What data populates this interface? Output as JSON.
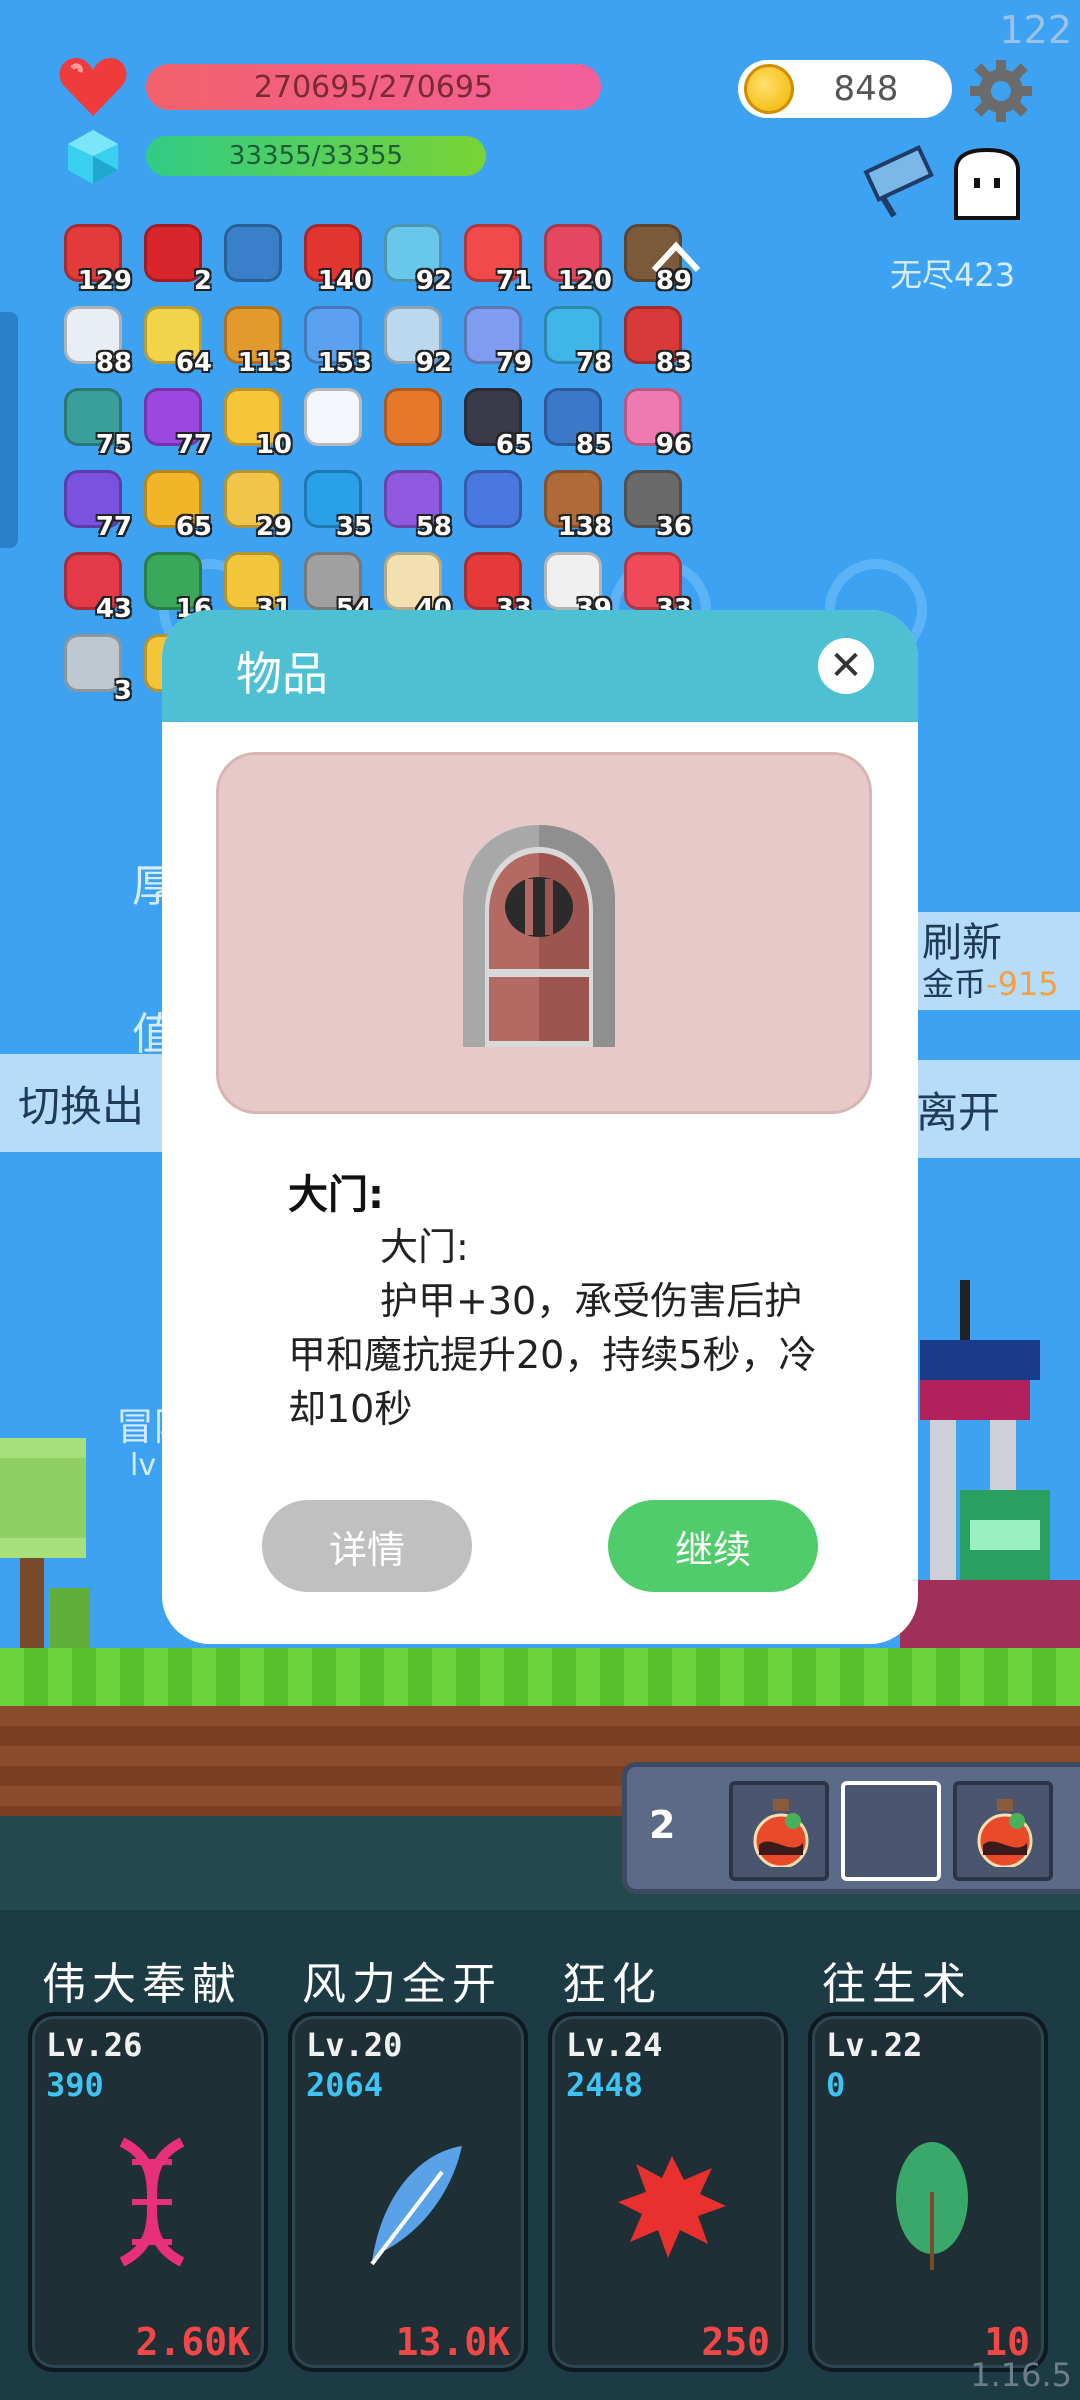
{
  "hud": {
    "fps": "122",
    "hp": "270695/270695",
    "mp": "33355/33355",
    "coins": "848",
    "mode": "无尽423",
    "version": "1.16.5"
  },
  "items": [
    {
      "icon": "red-boot-icon",
      "color": "#e33a3a",
      "count": "129"
    },
    {
      "icon": "magnet-icon",
      "color": "#d8262c",
      "count": "2"
    },
    {
      "icon": "magnifier-icon",
      "color": "#3a80c8",
      "count": ""
    },
    {
      "icon": "apple-icon",
      "color": "#e3352f",
      "count": "140"
    },
    {
      "icon": "potion-icon",
      "color": "#69c8ea",
      "count": "92"
    },
    {
      "icon": "pill-icon",
      "color": "#f04a4a",
      "count": "71"
    },
    {
      "icon": "jam-jar-icon",
      "color": "#e64760",
      "count": "120"
    },
    {
      "icon": "coconut-icon",
      "color": "#7b5a3b",
      "count": "89"
    },
    {
      "icon": "envelope-icon",
      "color": "#e9eef4",
      "count": "88"
    },
    {
      "icon": "halo-icon",
      "color": "#f3d34a",
      "count": "64"
    },
    {
      "icon": "book-icon",
      "color": "#e39a2d",
      "count": "113"
    },
    {
      "icon": "star-card-icon",
      "color": "#5aa2f0",
      "count": "153"
    },
    {
      "icon": "flask-icon",
      "color": "#bcd8ee",
      "count": "92"
    },
    {
      "icon": "capsule-icon",
      "color": "#7f9cf0",
      "count": "79"
    },
    {
      "icon": "speech-bubble-icon",
      "color": "#3fb5e8",
      "count": "78"
    },
    {
      "icon": "red-shield-icon",
      "color": "#d83a3a",
      "count": "83"
    },
    {
      "icon": "disc-icon",
      "color": "#3a9f9a",
      "count": "75"
    },
    {
      "icon": "crystal-ball-icon",
      "color": "#9b47e0",
      "count": "77"
    },
    {
      "icon": "sun-icon",
      "color": "#f6c63a",
      "count": "10"
    },
    {
      "icon": "wing-icon",
      "color": "#f3f6fb",
      "count": ""
    },
    {
      "icon": "orange-potion-icon",
      "color": "#e6782a",
      "count": ""
    },
    {
      "icon": "cauldron-icon",
      "color": "#3a3a48",
      "count": "65"
    },
    {
      "icon": "blue-shield-icon",
      "color": "#3a78c8",
      "count": "85"
    },
    {
      "icon": "spray-bottle-icon",
      "color": "#f07ab0",
      "count": "96"
    },
    {
      "icon": "purple-box-icon",
      "color": "#7b52e0",
      "count": "77"
    },
    {
      "icon": "sunflower-icon",
      "color": "#f2b52a",
      "count": "65"
    },
    {
      "icon": "ring-icon",
      "color": "#f1c54a",
      "count": "29"
    },
    {
      "icon": "blue-gem-icon",
      "color": "#2aa0e8",
      "count": "35"
    },
    {
      "icon": "purple-shield-icon",
      "color": "#8f5ae0",
      "count": "58"
    },
    {
      "icon": "tarot-card-icon",
      "color": "#4a78e0",
      "count": ""
    },
    {
      "icon": "donut-icon",
      "color": "#b06a3a",
      "count": "138"
    },
    {
      "icon": "hook-icon",
      "color": "#6a6a6a",
      "count": "36"
    },
    {
      "icon": "heart-plus-icon",
      "color": "#e33a4a",
      "count": "43"
    },
    {
      "icon": "cash-icon",
      "color": "#3aa85a",
      "count": "16"
    },
    {
      "icon": "magic-wand-icon",
      "color": "#f2c53a",
      "count": "31"
    },
    {
      "icon": "door-icon",
      "color": "#a0a0a0",
      "count": "54"
    },
    {
      "icon": "milk-icon",
      "color": "#f3e0b0",
      "count": "40"
    },
    {
      "icon": "strawberry-icon",
      "color": "#e63a3a",
      "count": "33"
    },
    {
      "icon": "egg-icon",
      "color": "#f0f0f0",
      "count": "39"
    },
    {
      "icon": "big-heart-icon",
      "color": "#ef4a5a",
      "count": "33"
    },
    {
      "icon": "compass-icon",
      "color": "#bfc8cf",
      "count": "3"
    },
    {
      "icon": "crown-icon",
      "color": "#f3c53a",
      "count": ""
    },
    {
      "icon": "light-tile-icon",
      "color": "#8ee0f0",
      "count": ""
    }
  ],
  "background_ui": {
    "refresh_label": "刷新",
    "refresh_cost_prefix": "金币",
    "refresh_cost": "-915",
    "leave_label": "离开",
    "switch_label": "切换出",
    "partial_1": "厚",
    "partial_2": "值",
    "partial_3": "冒险",
    "partial_4": "lv"
  },
  "slots": {
    "count": "2",
    "filled": [
      true,
      false,
      true
    ]
  },
  "skills": [
    {
      "name": "伟大奉献",
      "level": "Lv.26",
      "value": "390",
      "cost": "2.60K",
      "icon": "dna-icon",
      "color": "#e8307a"
    },
    {
      "name": "风力全开",
      "level": "Lv.20",
      "value": "2064",
      "cost": "13.0K",
      "icon": "feather-icon",
      "color": "#5aa2e8"
    },
    {
      "name": "狂化",
      "level": "Lv.24",
      "value": "2448",
      "cost": "250",
      "icon": "blood-splat-icon",
      "color": "#e8302f"
    },
    {
      "name": "往生术",
      "level": "Lv.22",
      "value": "0",
      "cost": "10",
      "icon": "leaf-icon",
      "color": "#3aa86a"
    }
  ],
  "dialog": {
    "title": "物品",
    "item_name": "大门:",
    "desc_line1": "大门:",
    "desc_line2": "护甲+30，承受伤害后护甲和魔抗提升20，持续5秒，冷却10秒",
    "detail_label": "详情",
    "continue_label": "继续",
    "image_bg": "#e8c9c9"
  }
}
